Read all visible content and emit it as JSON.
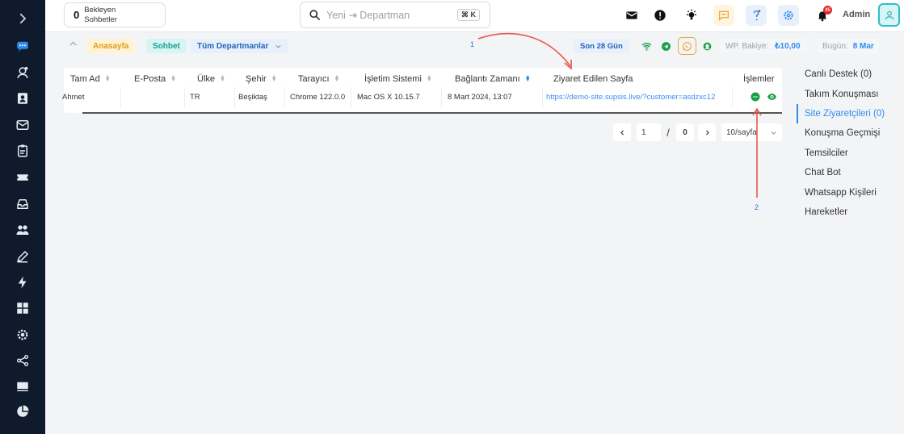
{
  "sidebar": {
    "items": [
      {
        "icon": "chevron-right-icon"
      },
      {
        "icon": "chat-bubbles-icon"
      },
      {
        "icon": "visitors-icon"
      },
      {
        "icon": "contact-card-icon"
      },
      {
        "icon": "mail-icon"
      },
      {
        "icon": "clipboard-icon"
      },
      {
        "icon": "ticket-icon"
      },
      {
        "icon": "inbox-icon"
      },
      {
        "icon": "users-icon"
      },
      {
        "icon": "pen-icon"
      },
      {
        "icon": "bolt-icon"
      },
      {
        "icon": "grid-icon"
      },
      {
        "icon": "settings-icon"
      },
      {
        "icon": "share-icon"
      },
      {
        "icon": "monitor-icon"
      },
      {
        "icon": "pie-chart-icon"
      }
    ]
  },
  "topbar": {
    "waiting_count": "0",
    "waiting_label": "Bekleyen Sohbetler",
    "search_placeholder": "Yeni ⇥ Departman",
    "search_shortcut": "⌘ K",
    "bell_count": "35",
    "user_name": "Admin",
    "icons": [
      "mail-icon",
      "alert-icon",
      "bulb-icon",
      "chat-feedback-icon",
      "help-icon",
      "gear-icon",
      "bell-icon",
      "user-avatar-icon"
    ]
  },
  "subbar": {
    "home": "Anasayfa",
    "chat": "Sohbet",
    "departments": "Tüm Departmanlar",
    "range": "Son 28 Gün",
    "wp_balance_label": "WP. Bakiye:",
    "wp_balance_value": "₺10,00",
    "today_label": "Bugün:",
    "today_value": "8 Mar"
  },
  "table": {
    "headers": [
      "Tam Ad",
      "E-Posta",
      "Ülke",
      "Şehir",
      "Tarayıcı",
      "İşletim Sistemi",
      "Bağlantı Zamanı",
      "Ziyaret Edilen Sayfa",
      "İşlemler"
    ],
    "rows": [
      {
        "name": "Ahmet",
        "email": "",
        "country": "TR",
        "city": "Beşiktaş",
        "browser": "Chrome 122.0.0",
        "os": "Mac OS X 10.15.7",
        "time": "8 Mart 2024, 13:07",
        "page": "https://demo-site.supsis.live/?customer=asdzxc12"
      }
    ]
  },
  "pagination": {
    "current": "1",
    "separator": "/",
    "total": "0",
    "page_size": "10/sayfa"
  },
  "rightnav": {
    "items": [
      {
        "label": "Canlı Destek (0)",
        "active": false
      },
      {
        "label": "Takım Konuşması",
        "active": false
      },
      {
        "label": "Site Ziyaretçileri (0)",
        "active": true
      },
      {
        "label": "Konuşma Geçmişi",
        "active": false
      },
      {
        "label": "Temsilciler",
        "active": false
      },
      {
        "label": "Chat Bot",
        "active": false
      },
      {
        "label": "Whatsapp Kişileri",
        "active": false
      },
      {
        "label": "Hareketler",
        "active": false
      }
    ]
  },
  "annotations": {
    "one": "1",
    "two": "2"
  },
  "colors": {
    "sidebar": "#0f1b2d",
    "accent": "#2d8cf0",
    "annotation_arrow": "#e8564c"
  }
}
